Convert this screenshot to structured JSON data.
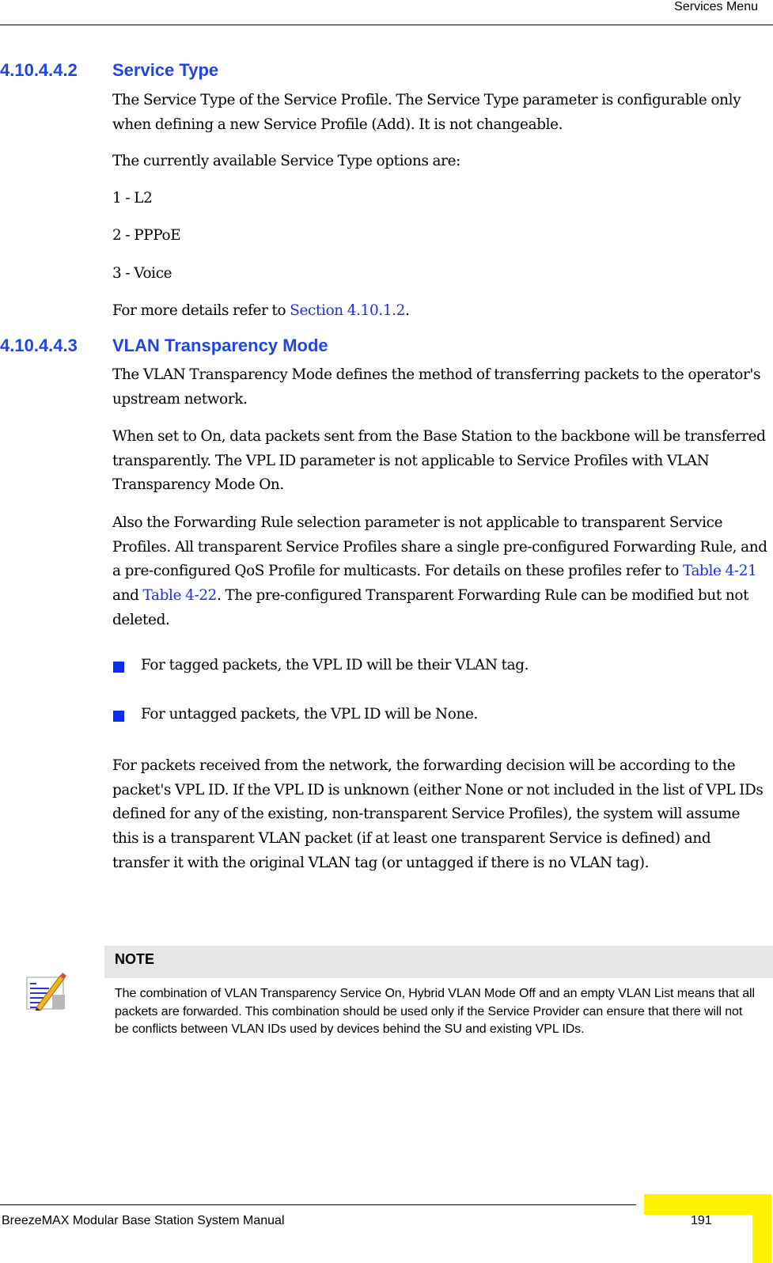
{
  "header": {
    "section_title": "Services Menu"
  },
  "sections": [
    {
      "number": "4.10.4.4.2",
      "title": "Service Type",
      "intro": "The Service Type of the Service Profile. The Service Type parameter is configurable only when defining a new Service Profile (Add). It is not changeable.",
      "options_intro": "The currently available Service Type options are:",
      "options": [
        "1 - L2",
        "2 - PPPoE",
        "3 - Voice"
      ],
      "more_details_prefix": "For more details refer to ",
      "more_details_link": "Section 4.10.1.2",
      "more_details_suffix": "."
    },
    {
      "number": "4.10.4.4.3",
      "title": "VLAN Transparency Mode",
      "para1": "The VLAN Transparency Mode defines the method of transferring packets to the operator's upstream network.",
      "para2": "When set to On, data packets sent from the Base Station to the backbone will be transferred transparently. The VPL ID parameter is not applicable to Service Profiles with VLAN Transparency Mode On.",
      "para3_part1": "Also the Forwarding Rule selection parameter is not applicable to transparent Service Profiles. All transparent Service Profiles share a single pre-configured Forwarding Rule, and a pre-configured QoS Profile for multicasts. For details on these profiles refer to ",
      "para3_link1": "Table 4-21",
      "para3_part2": " and ",
      "para3_link2": "Table 4-22",
      "para3_part3": ". The pre-configured Transparent Forwarding Rule can be modified but not deleted.",
      "bullets": [
        "For tagged packets, the VPL ID will be their VLAN tag.",
        "For untagged packets, the VPL ID will be None."
      ],
      "para4": "For packets received from the network, the forwarding decision will be according to the packet's VPL ID. If the VPL ID is unknown (either None or not included in the list of VPL IDs defined for any of the existing, non-transparent Service Profiles), the system will assume this is a transparent VLAN packet (if at least one transparent Service is defined) and transfer it with the original VLAN tag (or untagged if there is no VLAN tag)."
    }
  ],
  "note": {
    "label": "NOTE",
    "icon": "note-pencil-icon",
    "text": "The combination of VLAN Transparency Service On, Hybrid VLAN Mode Off and an empty VLAN List means that all packets are forwarded. This combination should be used only if the Service Provider can ensure that there will not be conflicts between VLAN IDs used by devices behind the SU and existing VPL IDs."
  },
  "footer": {
    "manual_title": "BreezeMAX Modular Base Station System Manual",
    "page_number": "191"
  },
  "colors": {
    "heading": "#1f45e6",
    "link": "#1f2bf0",
    "bullet": "#0a2df5",
    "note_bar": "#e6e6e6",
    "corner_accent": "#fff200"
  }
}
